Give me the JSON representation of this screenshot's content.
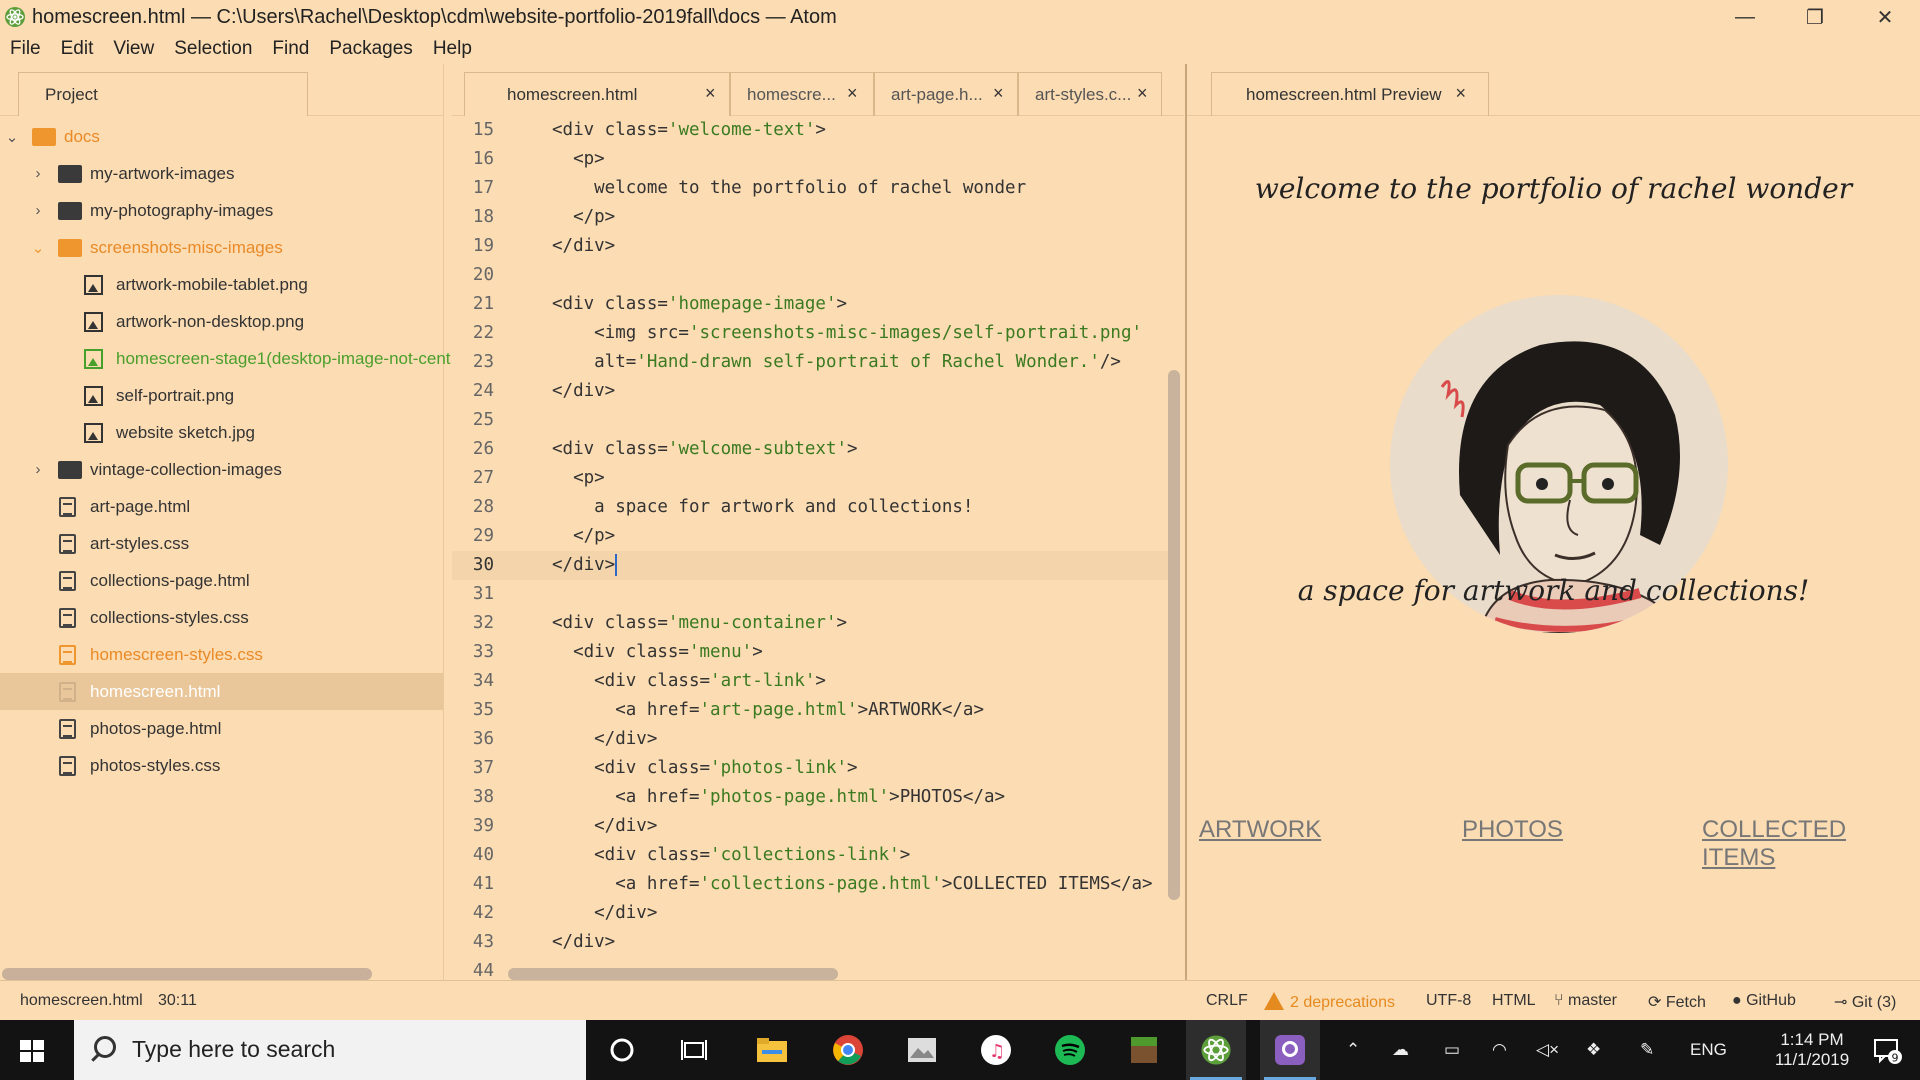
{
  "window": {
    "title": "homescreen.html — C:\\Users\\Rachel\\Desktop\\cdm\\website-portfolio-2019fall\\docs — Atom",
    "buttons": {
      "minimize": "—",
      "restore": "❐",
      "close": "✕"
    }
  },
  "menubar": {
    "items": [
      "File",
      "Edit",
      "View",
      "Selection",
      "Find",
      "Packages",
      "Help"
    ]
  },
  "tree": {
    "tab_label": "Project",
    "root": "docs",
    "items": [
      {
        "label": "my-artwork-images"
      },
      {
        "label": "my-photography-images"
      },
      {
        "label": "screenshots-misc-images"
      },
      {
        "label": "artwork-mobile-tablet.png"
      },
      {
        "label": "artwork-non-desktop.png"
      },
      {
        "label": "homescreen-stage1(desktop-image-not-cent"
      },
      {
        "label": "self-portrait.png"
      },
      {
        "label": "website sketch.jpg"
      },
      {
        "label": "vintage-collection-images"
      },
      {
        "label": "art-page.html"
      },
      {
        "label": "art-styles.css"
      },
      {
        "label": "collections-page.html"
      },
      {
        "label": "collections-styles.css"
      },
      {
        "label": "homescreen-styles.css"
      },
      {
        "label": "homescreen.html"
      },
      {
        "label": "photos-page.html"
      },
      {
        "label": "photos-styles.css"
      }
    ]
  },
  "editor": {
    "tabs": [
      "homescreen.html",
      "homescre...",
      "art-page.h...",
      "art-styles.c..."
    ],
    "close_glyph": "×",
    "lines": [
      {
        "n": "15",
        "src": "<div class='welcome-text'>"
      },
      {
        "n": "16",
        "src": "  <p>"
      },
      {
        "n": "17",
        "src": "    welcome to the portfolio of rachel wonder"
      },
      {
        "n": "18",
        "src": "  </p>"
      },
      {
        "n": "19",
        "src": "</div>"
      },
      {
        "n": "20",
        "src": ""
      },
      {
        "n": "21",
        "src": "<div class='homepage-image'>"
      },
      {
        "n": "22",
        "src": "    <img src='screenshots-misc-images/self-portrait.png'"
      },
      {
        "n": "23",
        "src": "    alt='Hand-drawn self-portrait of Rachel Wonder.'/>"
      },
      {
        "n": "24",
        "src": "</div>"
      },
      {
        "n": "25",
        "src": ""
      },
      {
        "n": "26",
        "src": "<div class='welcome-subtext'>"
      },
      {
        "n": "27",
        "src": "  <p>"
      },
      {
        "n": "28",
        "src": "    a space for artwork and collections!"
      },
      {
        "n": "29",
        "src": "  </p>"
      },
      {
        "n": "30",
        "src": "</div>"
      },
      {
        "n": "31",
        "src": ""
      },
      {
        "n": "32",
        "src": "<div class='menu-container'>"
      },
      {
        "n": "33",
        "src": "  <div class='menu'>"
      },
      {
        "n": "34",
        "src": "    <div class='art-link'>"
      },
      {
        "n": "35",
        "src": "      <a href='art-page.html'>ARTWORK</a>"
      },
      {
        "n": "36",
        "src": "    </div>"
      },
      {
        "n": "37",
        "src": "    <div class='photos-link'>"
      },
      {
        "n": "38",
        "src": "      <a href='photos-page.html'>PHOTOS</a>"
      },
      {
        "n": "39",
        "src": "    </div>"
      },
      {
        "n": "40",
        "src": "    <div class='collections-link'>"
      },
      {
        "n": "41",
        "src": "      <a href='collections-page.html'>COLLECTED ITEMS</a>"
      },
      {
        "n": "42",
        "src": "    </div>"
      },
      {
        "n": "43",
        "src": "</div>"
      },
      {
        "n": "44",
        "src": ""
      }
    ],
    "current_line": "30"
  },
  "preview": {
    "tab_label": "homescreen.html Preview",
    "welcome": "welcome to the portfolio of rachel wonder",
    "subtext": "a space for artwork and collections!",
    "links": [
      "ARTWORK",
      "PHOTOS",
      "COLLECTED ITEMS"
    ]
  },
  "statusbar": {
    "file": "homescreen.html",
    "cursor": "30:11",
    "line_ending": "CRLF",
    "deprecations": "2 deprecations",
    "encoding": "UTF-8",
    "grammar": "HTML",
    "branch": "master",
    "fetch": "Fetch",
    "github": "GitHub",
    "git": "Git (3)"
  },
  "taskbar": {
    "search_placeholder": "Type here to search",
    "language": "ENG",
    "time": "1:14 PM",
    "date": "11/1/2019",
    "notification_count": "9"
  },
  "colors": {
    "background": "#fcdcb3",
    "accent_orange": "#f0962e",
    "string_green": "#3a7a20",
    "selection": "#e9c79b",
    "taskbar": "#131313"
  }
}
